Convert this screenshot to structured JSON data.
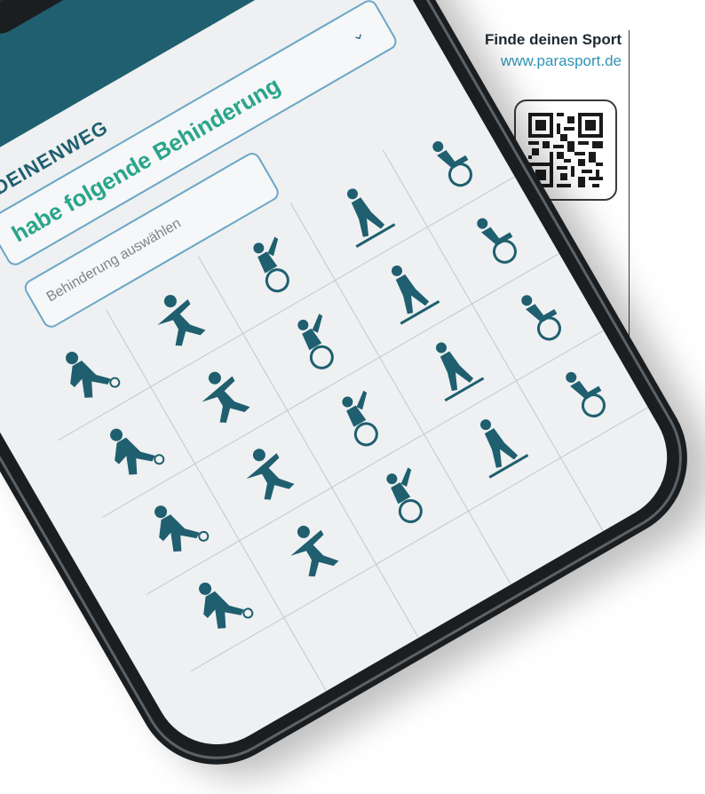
{
  "panel": {
    "title": "Finde deinen Sport",
    "url": "www.parasport.de"
  },
  "app": {
    "brand": "EDEINENWEG",
    "disability_label": "habe folgende Behinderung",
    "search_placeholder": "Behinderung auswählen"
  },
  "sports_icons": [
    "para-football-icon",
    "para-volleyball-icon",
    "wheelchair-badminton-icon",
    "para-ski-icon",
    "wheelchair-curling-icon",
    "para-archery-icon",
    "rhythmic-gymnastics-icon",
    "para-powerlifting-icon",
    "para-judo-icon",
    "para-canoe-icon",
    "para-sprint-icon",
    "para-cycling-icon",
    "para-swimming-icon",
    "para-sitski-icon",
    "para-triathlon-icon",
    "para-climbing-icon",
    "para-taekwondo-icon",
    "wheelchair-tennis-icon",
    "para-rowing-icon",
    "wheelchair-fencing-icon"
  ],
  "colors": {
    "accent": "#1f5f6f",
    "link": "#2f93b4",
    "label_green": "#2aa58a"
  }
}
